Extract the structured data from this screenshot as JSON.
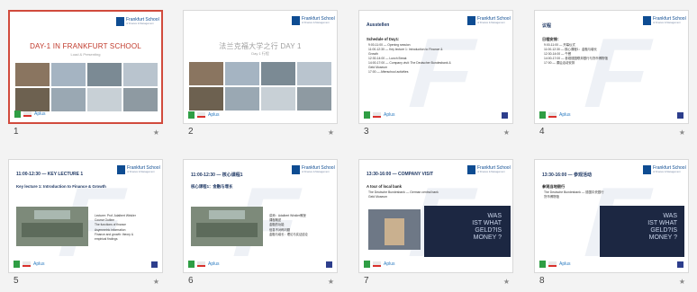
{
  "colors": {
    "accent_red": "#d14a3c",
    "brand_blue": "#0e4c92",
    "heading": "#1f3864"
  },
  "slides": [
    {
      "number": "1",
      "title": "DAY-1 IN FRANKFURT SCHOOL",
      "subtitle": "Load & Presenting",
      "logo_name": "Frankfurt School",
      "logo_tag": "of Finance & Management",
      "footer_brand": "Aplus"
    },
    {
      "number": "2",
      "title": "法兰克福大学之行 DAY 1",
      "subtitle": "Day 1 行程",
      "logo_name": "Frankfurt School",
      "logo_tag": "of Finance & Management",
      "footer_brand": "Aplus"
    },
    {
      "number": "3",
      "title": "Ausstellen",
      "body_title": "Schedule of Day1:",
      "lines": [
        "9:00-11:00 — Opening session",
        "11:00-12:30 — Key lecture 1: Introduction to Finance &",
        "Growth",
        "12:30-14:00 — Lunch Break",
        "14:00-17:00 — Company visit: The Deutscher Bundesbank &",
        "Geld Museum",
        "17:00 — Afterschool activities"
      ],
      "logo_name": "Frankfurt School",
      "logo_tag": "of Finance & Management",
      "footer_brand": "Aplus"
    },
    {
      "number": "4",
      "title": "议程",
      "body_title": "日程安排：",
      "lines": [
        "9:00-11:00 — 开幕仪式",
        "11:00-12:30 — 核心课程1：金融与增长",
        "12:30-14:00 — 午餐",
        "14:00-17:00 — 参观德国联邦银行与货币博物馆",
        "17:00 — 课后活动安排"
      ],
      "logo_name": "Frankfurt School",
      "logo_tag": "of Finance & Management",
      "footer_brand": "Aplus"
    },
    {
      "number": "5",
      "title": "11:00-12:30 — KEY LECTURE 1",
      "key_title": "Key lecture 1: Introduction to Finance & Growth",
      "lines": [
        "Lecturer: Prof. Adalbert Winkler",
        "Course Outline",
        "The functions of finance",
        "Asymmetric information",
        "Finance and growth: theory &",
        "empirical findings"
      ],
      "logo_name": "Frankfurt School",
      "logo_tag": "of Finance & Management",
      "footer_brand": "Aplus"
    },
    {
      "number": "6",
      "title": "11:00-12:30 — 核心课程1",
      "key_title": "核心课程1：金融与增长",
      "lines": [
        "讲师：Adalbert Winkler教授",
        "课程概述",
        "金融的功能",
        "信息不对称问题",
        "金融与增长：理论与实证结论"
      ],
      "logo_name": "Frankfurt School",
      "logo_tag": "of Finance & Management",
      "footer_brand": "Aplus"
    },
    {
      "number": "7",
      "title": "13:30-16:00 — COMPANY VISIT",
      "body_title": "A tour of local bank",
      "lines": [
        "The Deutsche Bundesbank — German central bank",
        "Geld Museum"
      ],
      "photo_text": [
        "WAS",
        "IST WHAT",
        "GELD?IS",
        "MONEY ?"
      ],
      "logo_name": "Frankfurt School",
      "logo_tag": "of Finance & Management",
      "footer_brand": "Aplus"
    },
    {
      "number": "8",
      "title": "13:30-16:00 — 参观活动",
      "body_title": "参观当地银行",
      "lines": [
        "The Deutsche Bundesbank — 德国中央银行",
        "货币博物馆"
      ],
      "photo_text": [
        "WAS",
        "IST WHAT",
        "GELD?IS",
        "MONEY ?"
      ],
      "logo_name": "Frankfurt School",
      "logo_tag": "of Finance & Management",
      "footer_brand": "Aplus"
    }
  ],
  "icons": {
    "star": "star-icon"
  }
}
